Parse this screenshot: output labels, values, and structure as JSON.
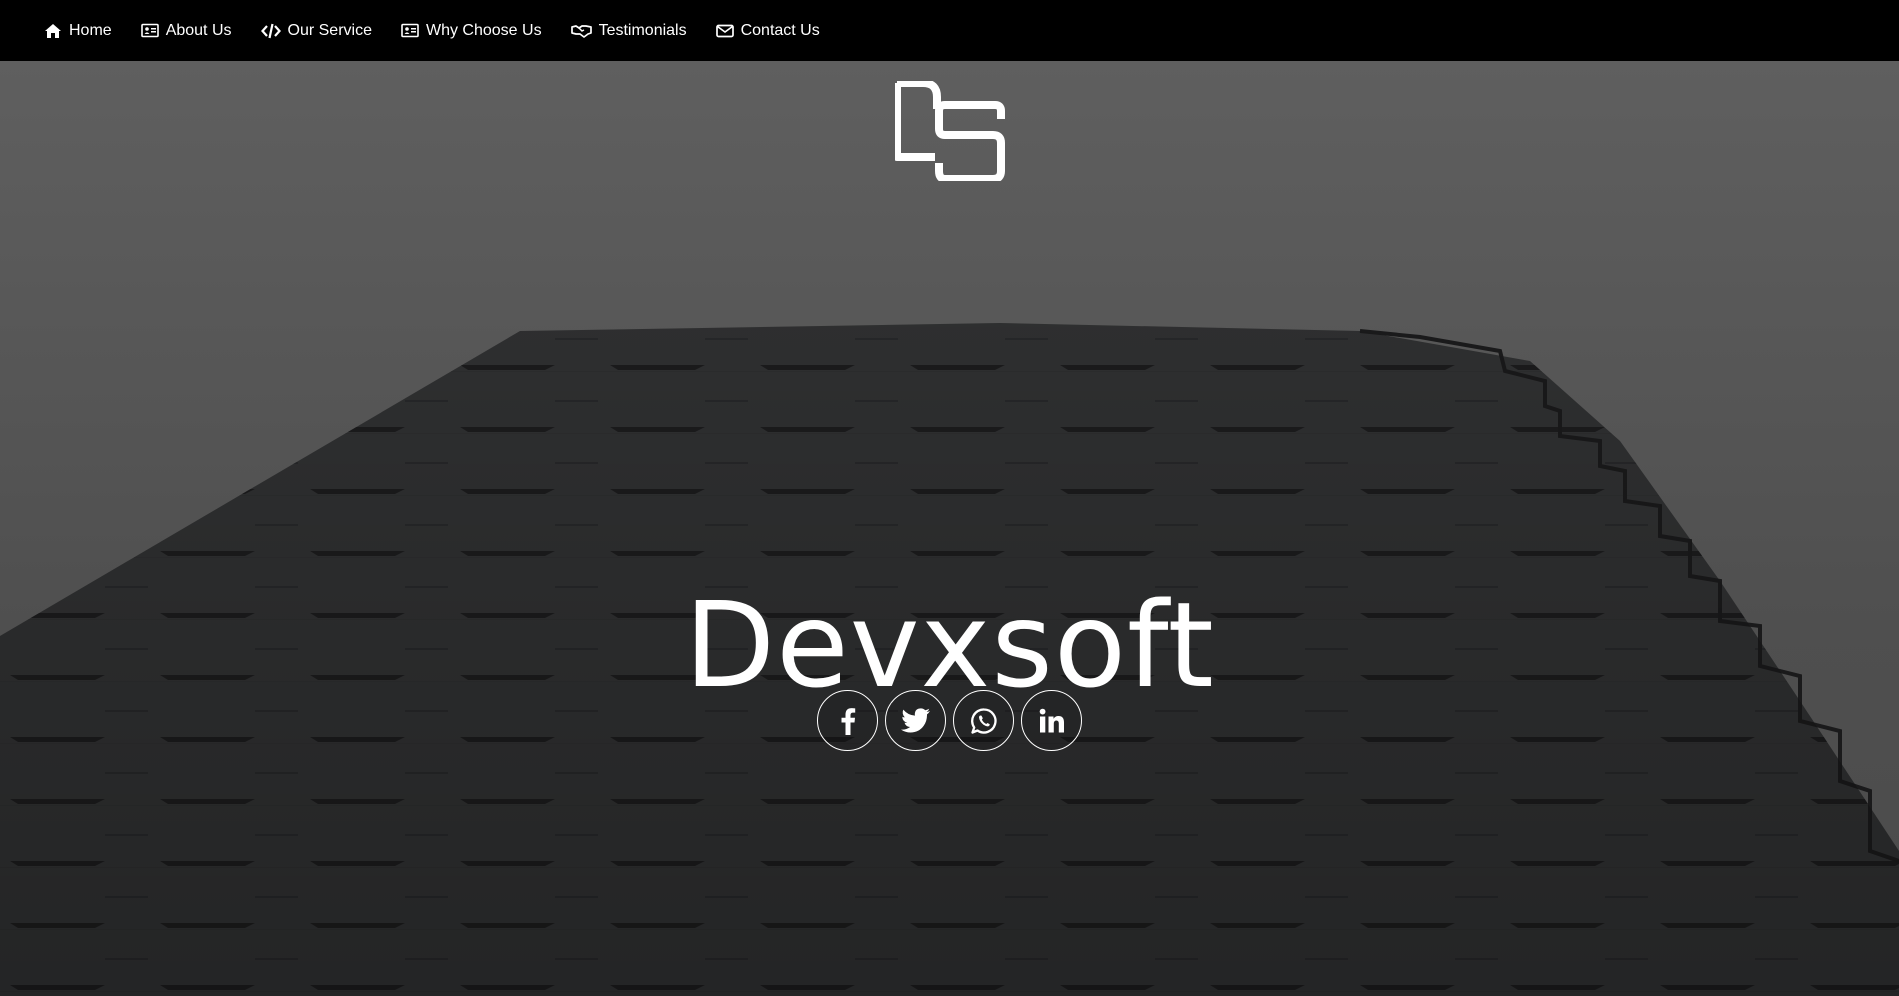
{
  "nav": {
    "items": [
      {
        "label": "Home",
        "icon": "home-icon"
      },
      {
        "label": "About Us",
        "icon": "id-card-icon"
      },
      {
        "label": "Our Service",
        "icon": "code-icon"
      },
      {
        "label": "Why Choose Us",
        "icon": "id-card-icon"
      },
      {
        "label": "Testimonials",
        "icon": "handshake-icon"
      },
      {
        "label": "Contact Us",
        "icon": "envelope-icon"
      }
    ]
  },
  "hero": {
    "logo": "DS",
    "title": "Devxsoft",
    "socials": [
      {
        "name": "Facebook",
        "icon": "facebook-icon"
      },
      {
        "name": "Twitter",
        "icon": "twitter-icon"
      },
      {
        "name": "WhatsApp",
        "icon": "whatsapp-icon"
      },
      {
        "name": "LinkedIn",
        "icon": "linkedin-icon"
      }
    ]
  },
  "colors": {
    "navbar_bg": "#000000",
    "text": "#ffffff",
    "building": "#303132",
    "sky": "#5a5a5a"
  }
}
